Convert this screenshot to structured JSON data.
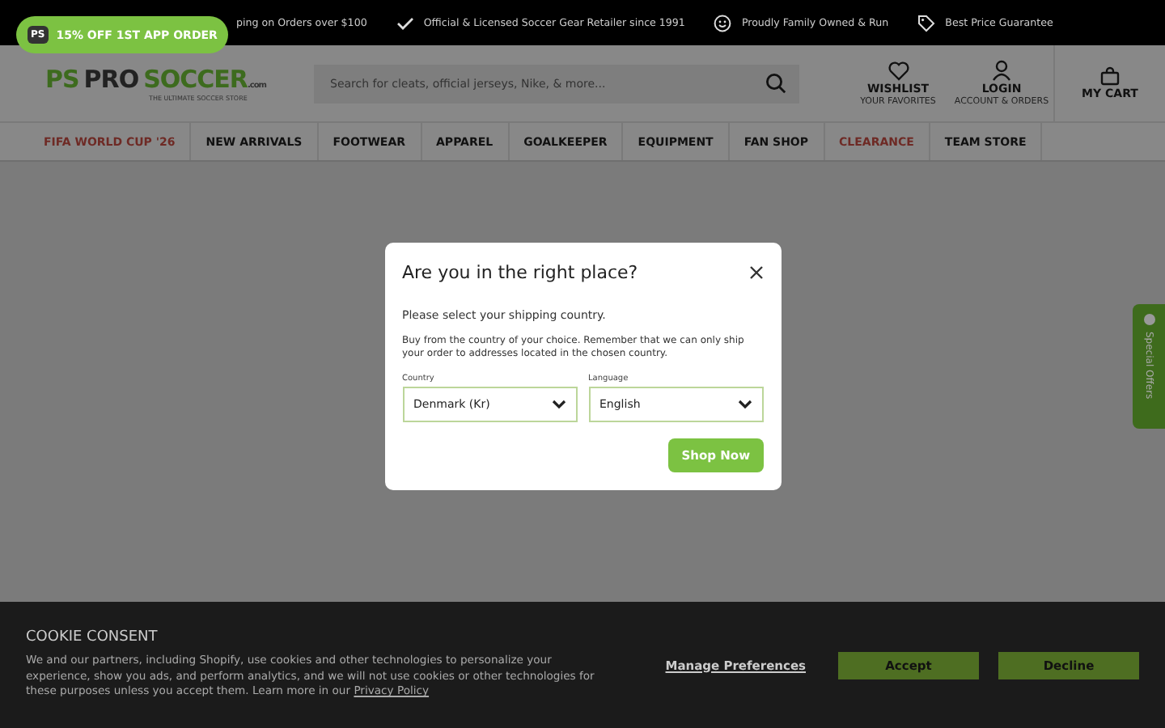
{
  "promo_badge": {
    "logo": "PS",
    "label": "15% OFF 1ST APP ORDER"
  },
  "top_bar": [
    {
      "kind": "text",
      "label": "ping on Orders over $100"
    },
    {
      "kind": "check",
      "label": "Official & Licensed Soccer Gear Retailer since 1991"
    },
    {
      "kind": "smile",
      "label": "Proudly Family Owned & Run"
    },
    {
      "kind": "tag",
      "label": "Best Price Guarantee"
    }
  ],
  "logo": {
    "mark": "PS",
    "name_1": "PRO",
    "name_2": "SOCCER",
    "suffix": ".com",
    "tagline": "THE ULTIMATE SOCCER STORE"
  },
  "search": {
    "placeholder": "Search for cleats, official jerseys, Nike, & more..."
  },
  "header_links": [
    {
      "kind": "heart",
      "label": "WISHLIST",
      "sub": "YOUR FAVORITES"
    },
    {
      "kind": "user",
      "label": "LOGIN",
      "sub": "ACCOUNT & ORDERS"
    },
    {
      "kind": "bag",
      "label": "MY CART"
    }
  ],
  "nav": [
    {
      "label": "FIFA WORLD CUP '26",
      "highlight": true
    },
    {
      "label": "NEW ARRIVALS",
      "highlight": false
    },
    {
      "label": "FOOTWEAR",
      "highlight": false
    },
    {
      "label": "APPAREL",
      "highlight": false
    },
    {
      "label": "GOALKEEPER",
      "highlight": false
    },
    {
      "label": "EQUIPMENT",
      "highlight": false
    },
    {
      "label": "FAN SHOP",
      "highlight": false
    },
    {
      "label": "CLEARANCE",
      "highlight": true
    },
    {
      "label": "TEAM STORE",
      "highlight": false
    }
  ],
  "modal": {
    "title": "Are you in the right place?",
    "subtitle": "Please select your shipping country.",
    "body": "Buy from the country of your choice. Remember that we can only ship your order to addresses located in the chosen country.",
    "fields": [
      {
        "label": "Country",
        "value": "Denmark (Kr)"
      },
      {
        "label": "Language",
        "value": "English"
      }
    ],
    "button": "Shop Now"
  },
  "side_tab": {
    "label": "Special Offers"
  },
  "cookie": {
    "title": "COOKIE CONSENT",
    "text": "We and our partners, including Shopify, use cookies and other technologies to personalize your experience, show you ads, and perform analytics, and we will not use cookies or other technologies for these purposes unless you accept them. Learn more in our",
    "link": "Privacy Policy",
    "manage": "Manage Preferences",
    "accept": "Accept",
    "decline": "Decline"
  }
}
